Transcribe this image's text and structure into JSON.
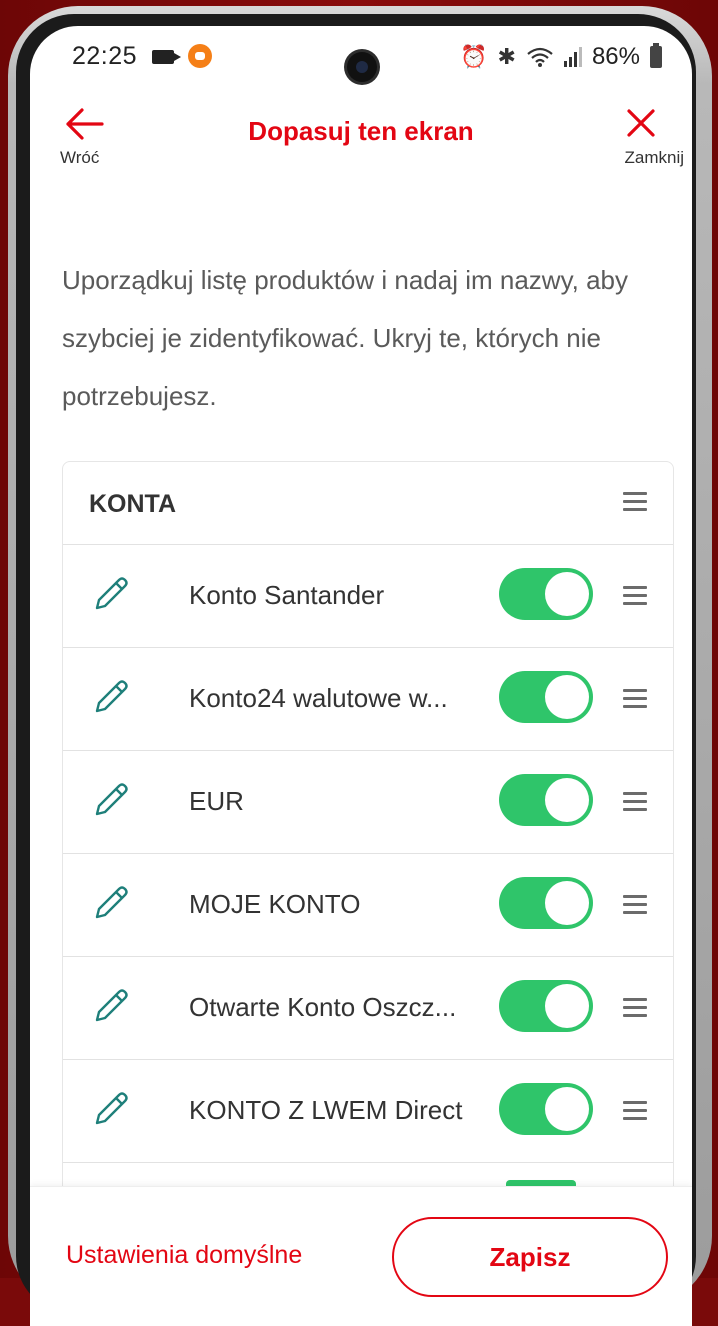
{
  "status_bar": {
    "time": "22:25",
    "battery": "86%"
  },
  "header": {
    "back_label": "Wróć",
    "title": "Dopasuj ten ekran",
    "close_label": "Zamknij"
  },
  "intro_text": "Uporządkuj listę produktów i nadaj im nazwy, aby szybciej je zidentyfikować. Ukryj te, których nie potrzebujesz.",
  "section": {
    "title": "KONTA",
    "items": [
      {
        "label": "Konto Santander",
        "enabled": true
      },
      {
        "label": "Konto24 walutowe w...",
        "enabled": true
      },
      {
        "label": "EUR",
        "enabled": true
      },
      {
        "label": "MOJE KONTO",
        "enabled": true
      },
      {
        "label": "Otwarte Konto Oszcz...",
        "enabled": true
      },
      {
        "label": "KONTO Z LWEM Direct",
        "enabled": true
      }
    ]
  },
  "footer": {
    "defaults_label": "Ustawienia domyślne",
    "save_label": "Zapisz"
  },
  "colors": {
    "brand_red": "#e30613",
    "toggle_on": "#2fc56a",
    "pencil_teal": "#1e7f7a"
  }
}
